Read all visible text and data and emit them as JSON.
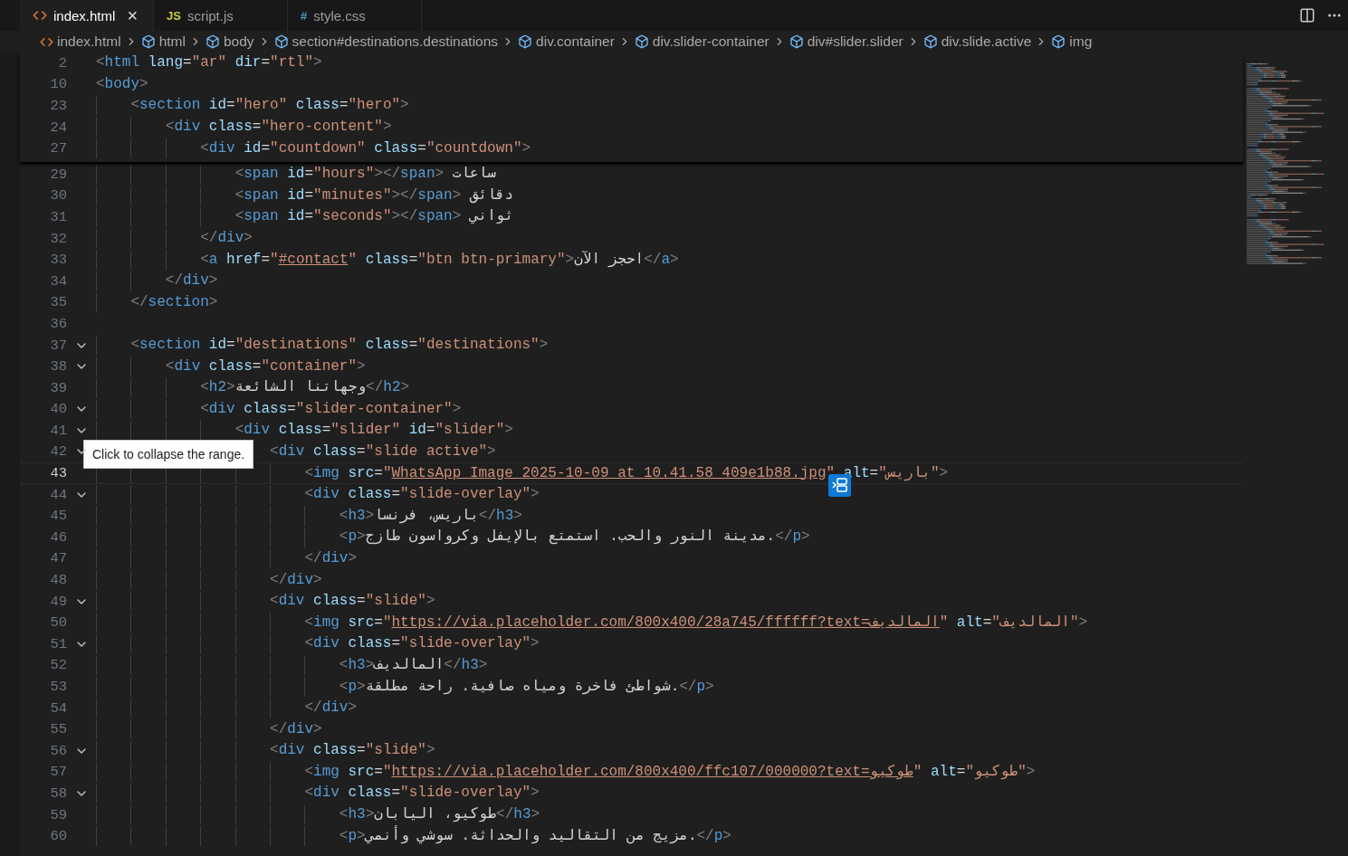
{
  "tabs": [
    {
      "label": "index.html",
      "kind": "html",
      "selected": true,
      "close": "×"
    },
    {
      "label": "script.js",
      "kind": "js",
      "glyph": "JS",
      "selected": false
    },
    {
      "label": "style.css",
      "kind": "css",
      "glyph": "#",
      "selected": false
    }
  ],
  "breadcrumb": [
    {
      "label": "index.html",
      "kind": "file"
    },
    {
      "label": "html",
      "kind": "element"
    },
    {
      "label": "body",
      "kind": "element"
    },
    {
      "label": "section#destinations.destinations",
      "kind": "element"
    },
    {
      "label": "div.container",
      "kind": "element"
    },
    {
      "label": "div.slider-container",
      "kind": "element"
    },
    {
      "label": "div#slider.slider",
      "kind": "element"
    },
    {
      "label": "div.slide.active",
      "kind": "element"
    },
    {
      "label": "img",
      "kind": "element"
    }
  ],
  "sticky_lines": [
    {
      "number": "2",
      "tokens": [
        {
          "kind": "br",
          "text": "<"
        },
        {
          "kind": "tag",
          "text": "html"
        },
        {
          "kind": "attr",
          "text": " lang"
        },
        {
          "kind": "op",
          "text": "="
        },
        {
          "kind": "str",
          "text": "\"ar\""
        },
        {
          "kind": "attr",
          "text": " dir"
        },
        {
          "kind": "op",
          "text": "="
        },
        {
          "kind": "str",
          "text": "\"rtl\""
        },
        {
          "kind": "br",
          "text": ">"
        }
      ]
    },
    {
      "number": "10",
      "tokens": [
        {
          "kind": "br",
          "text": "<"
        },
        {
          "kind": "tag",
          "text": "body"
        },
        {
          "kind": "br",
          "text": ">"
        }
      ]
    },
    {
      "number": "23",
      "tokens": [
        {
          "kind": "br",
          "text": "    <"
        },
        {
          "kind": "tag",
          "text": "section"
        },
        {
          "kind": "attr",
          "text": " id"
        },
        {
          "kind": "op",
          "text": "="
        },
        {
          "kind": "str",
          "text": "\"hero\""
        },
        {
          "kind": "attr",
          "text": " class"
        },
        {
          "kind": "op",
          "text": "="
        },
        {
          "kind": "str",
          "text": "\"hero\""
        },
        {
          "kind": "br",
          "text": ">"
        }
      ]
    },
    {
      "number": "24",
      "tokens": [
        {
          "kind": "br",
          "text": "        <"
        },
        {
          "kind": "tag",
          "text": "div"
        },
        {
          "kind": "attr",
          "text": " class"
        },
        {
          "kind": "op",
          "text": "="
        },
        {
          "kind": "str",
          "text": "\"hero-content\""
        },
        {
          "kind": "br",
          "text": ">"
        }
      ]
    },
    {
      "number": "27",
      "tokens": [
        {
          "kind": "br",
          "text": "            <"
        },
        {
          "kind": "tag",
          "text": "div"
        },
        {
          "kind": "attr",
          "text": " id"
        },
        {
          "kind": "op",
          "text": "="
        },
        {
          "kind": "str",
          "text": "\"countdown\""
        },
        {
          "kind": "attr",
          "text": " class"
        },
        {
          "kind": "op",
          "text": "="
        },
        {
          "kind": "str",
          "text": "\"countdown\""
        },
        {
          "kind": "br",
          "text": ">"
        }
      ]
    }
  ],
  "lines": [
    {
      "number": "29",
      "current": false,
      "tokens": [
        {
          "kind": "br",
          "text": "                <"
        },
        {
          "kind": "tag",
          "text": "span"
        },
        {
          "kind": "attr",
          "text": " id"
        },
        {
          "kind": "op",
          "text": "="
        },
        {
          "kind": "str",
          "text": "\"hours\""
        },
        {
          "kind": "br",
          "text": "></"
        },
        {
          "kind": "tag",
          "text": "span"
        },
        {
          "kind": "br",
          "text": ">"
        },
        {
          "kind": "text",
          "text": " ساعات"
        }
      ]
    },
    {
      "number": "30",
      "current": false,
      "tokens": [
        {
          "kind": "br",
          "text": "                <"
        },
        {
          "kind": "tag",
          "text": "span"
        },
        {
          "kind": "attr",
          "text": " id"
        },
        {
          "kind": "op",
          "text": "="
        },
        {
          "kind": "str",
          "text": "\"minutes\""
        },
        {
          "kind": "br",
          "text": "></"
        },
        {
          "kind": "tag",
          "text": "span"
        },
        {
          "kind": "br",
          "text": ">"
        },
        {
          "kind": "text",
          "text": " دقائق"
        }
      ]
    },
    {
      "number": "31",
      "current": false,
      "tokens": [
        {
          "kind": "br",
          "text": "                <"
        },
        {
          "kind": "tag",
          "text": "span"
        },
        {
          "kind": "attr",
          "text": " id"
        },
        {
          "kind": "op",
          "text": "="
        },
        {
          "kind": "str",
          "text": "\"seconds\""
        },
        {
          "kind": "br",
          "text": "></"
        },
        {
          "kind": "tag",
          "text": "span"
        },
        {
          "kind": "br",
          "text": ">"
        },
        {
          "kind": "text",
          "text": " ثواني"
        }
      ]
    },
    {
      "number": "32",
      "current": false,
      "tokens": [
        {
          "kind": "br",
          "text": "            </"
        },
        {
          "kind": "tag",
          "text": "div"
        },
        {
          "kind": "br",
          "text": ">"
        }
      ]
    },
    {
      "number": "33",
      "current": false,
      "tokens": [
        {
          "kind": "br",
          "text": "            <"
        },
        {
          "kind": "tag",
          "text": "a"
        },
        {
          "kind": "attr",
          "text": " href"
        },
        {
          "kind": "op",
          "text": "="
        },
        {
          "kind": "str",
          "text": "\""
        },
        {
          "kind": "link",
          "text": "#contact"
        },
        {
          "kind": "str",
          "text": "\""
        },
        {
          "kind": "attr",
          "text": " class"
        },
        {
          "kind": "op",
          "text": "="
        },
        {
          "kind": "str",
          "text": "\"btn btn-primary\""
        },
        {
          "kind": "br",
          "text": ">"
        },
        {
          "kind": "text",
          "text": "احجز الآن"
        },
        {
          "kind": "br",
          "text": "</"
        },
        {
          "kind": "tag",
          "text": "a"
        },
        {
          "kind": "br",
          "text": ">"
        }
      ]
    },
    {
      "number": "34",
      "current": false,
      "tokens": [
        {
          "kind": "br",
          "text": "        </"
        },
        {
          "kind": "tag",
          "text": "div"
        },
        {
          "kind": "br",
          "text": ">"
        }
      ]
    },
    {
      "number": "35",
      "current": false,
      "tokens": [
        {
          "kind": "br",
          "text": "    </"
        },
        {
          "kind": "tag",
          "text": "section"
        },
        {
          "kind": "br",
          "text": ">"
        }
      ]
    },
    {
      "number": "36",
      "current": false
    },
    {
      "number": "37",
      "current": false,
      "folded": false,
      "tokens": [
        {
          "kind": "br",
          "text": "    <"
        },
        {
          "kind": "tag",
          "text": "section"
        },
        {
          "kind": "attr",
          "text": " id"
        },
        {
          "kind": "op",
          "text": "="
        },
        {
          "kind": "str",
          "text": "\"destinations\""
        },
        {
          "kind": "attr",
          "text": " class"
        },
        {
          "kind": "op",
          "text": "="
        },
        {
          "kind": "str",
          "text": "\"destinations\""
        },
        {
          "kind": "br",
          "text": ">"
        }
      ]
    },
    {
      "number": "38",
      "current": false,
      "folded": false,
      "tokens": [
        {
          "kind": "br",
          "text": "        <"
        },
        {
          "kind": "tag",
          "text": "div"
        },
        {
          "kind": "attr",
          "text": " class"
        },
        {
          "kind": "op",
          "text": "="
        },
        {
          "kind": "str",
          "text": "\"container\""
        },
        {
          "kind": "br",
          "text": ">"
        }
      ]
    },
    {
      "number": "39",
      "current": false,
      "tokens": [
        {
          "kind": "br",
          "text": "            <"
        },
        {
          "kind": "tag",
          "text": "h2"
        },
        {
          "kind": "br",
          "text": ">"
        },
        {
          "kind": "text",
          "text": "وجهاتنا الشائعة"
        },
        {
          "kind": "br",
          "text": "</"
        },
        {
          "kind": "tag",
          "text": "h2"
        },
        {
          "kind": "br",
          "text": ">"
        }
      ]
    },
    {
      "number": "40",
      "current": false,
      "folded": false,
      "tokens": [
        {
          "kind": "br",
          "text": "            <"
        },
        {
          "kind": "tag",
          "text": "div"
        },
        {
          "kind": "attr",
          "text": " class"
        },
        {
          "kind": "op",
          "text": "="
        },
        {
          "kind": "str",
          "text": "\"slider-container\""
        },
        {
          "kind": "br",
          "text": ">"
        }
      ]
    },
    {
      "number": "41",
      "current": false,
      "folded": false,
      "tokens": [
        {
          "kind": "br",
          "text": "                <"
        },
        {
          "kind": "tag",
          "text": "div"
        },
        {
          "kind": "attr",
          "text": " class"
        },
        {
          "kind": "op",
          "text": "="
        },
        {
          "kind": "str",
          "text": "\"slider\""
        },
        {
          "kind": "attr",
          "text": " id"
        },
        {
          "kind": "op",
          "text": "="
        },
        {
          "kind": "str",
          "text": "\"slider\""
        },
        {
          "kind": "br",
          "text": ">"
        }
      ]
    },
    {
      "number": "42",
      "current": false,
      "folded": false,
      "tooltip": "Click to collapse the range.",
      "tokens": [
        {
          "kind": "br",
          "text": "                    <"
        },
        {
          "kind": "tag",
          "text": "div"
        },
        {
          "kind": "attr",
          "text": " class"
        },
        {
          "kind": "op",
          "text": "="
        },
        {
          "kind": "str",
          "text": "\"slide active\""
        },
        {
          "kind": "br",
          "text": ">"
        }
      ]
    },
    {
      "number": "43",
      "current": true,
      "tokens": [
        {
          "kind": "br",
          "text": "                        <"
        },
        {
          "kind": "tag",
          "text": "img"
        },
        {
          "kind": "attr",
          "text": " src"
        },
        {
          "kind": "op",
          "text": "="
        },
        {
          "kind": "str",
          "text": "\""
        },
        {
          "kind": "link",
          "text": "WhatsApp Image 2025-10-09 at 10.41.58_409e1b88.jpg"
        },
        {
          "kind": "str",
          "text": "\""
        },
        {
          "kind": "attr",
          "text": " alt"
        },
        {
          "kind": "op",
          "text": "="
        },
        {
          "kind": "str",
          "text": "\"باريس\""
        },
        {
          "kind": "br",
          "text": ">"
        }
      ]
    },
    {
      "number": "44",
      "current": false,
      "folded": false,
      "action_icon": true,
      "tokens": [
        {
          "kind": "br",
          "text": "                        <"
        },
        {
          "kind": "tag",
          "text": "div"
        },
        {
          "kind": "attr",
          "text": " class"
        },
        {
          "kind": "op",
          "text": "="
        },
        {
          "kind": "str",
          "text": "\"slide-overlay\""
        },
        {
          "kind": "br",
          "text": ">"
        }
      ]
    },
    {
      "number": "45",
      "current": false,
      "tokens": [
        {
          "kind": "br",
          "text": "                            <"
        },
        {
          "kind": "tag",
          "text": "h3"
        },
        {
          "kind": "br",
          "text": ">"
        },
        {
          "kind": "text",
          "text": "باريس، فرنسا"
        },
        {
          "kind": "br",
          "text": "</"
        },
        {
          "kind": "tag",
          "text": "h3"
        },
        {
          "kind": "br",
          "text": ">"
        }
      ]
    },
    {
      "number": "46",
      "current": false,
      "tokens": [
        {
          "kind": "br",
          "text": "                            <"
        },
        {
          "kind": "tag",
          "text": "p"
        },
        {
          "kind": "br",
          "text": ">"
        },
        {
          "kind": "text",
          "text": "مدينة النور والحب. استمتع بالإيفل وكرواسون طازج."
        },
        {
          "kind": "br",
          "text": "</"
        },
        {
          "kind": "tag",
          "text": "p"
        },
        {
          "kind": "br",
          "text": ">"
        }
      ]
    },
    {
      "number": "47",
      "current": false,
      "tokens": [
        {
          "kind": "br",
          "text": "                        </"
        },
        {
          "kind": "tag",
          "text": "div"
        },
        {
          "kind": "br",
          "text": ">"
        }
      ]
    },
    {
      "number": "48",
      "current": false,
      "tokens": [
        {
          "kind": "br",
          "text": "                    </"
        },
        {
          "kind": "tag",
          "text": "div"
        },
        {
          "kind": "br",
          "text": ">"
        }
      ]
    },
    {
      "number": "49",
      "current": false,
      "folded": false,
      "tokens": [
        {
          "kind": "br",
          "text": "                    <"
        },
        {
          "kind": "tag",
          "text": "div"
        },
        {
          "kind": "attr",
          "text": " class"
        },
        {
          "kind": "op",
          "text": "="
        },
        {
          "kind": "str",
          "text": "\"slide\""
        },
        {
          "kind": "br",
          "text": ">"
        }
      ]
    },
    {
      "number": "50",
      "current": false,
      "tokens": [
        {
          "kind": "br",
          "text": "                        <"
        },
        {
          "kind": "tag",
          "text": "img"
        },
        {
          "kind": "attr",
          "text": " src"
        },
        {
          "kind": "op",
          "text": "="
        },
        {
          "kind": "str",
          "text": "\""
        },
        {
          "kind": "link",
          "text": "https://via.placeholder.com/800x400/28a745/ffffff?text=المالديف"
        },
        {
          "kind": "str",
          "text": "\""
        },
        {
          "kind": "attr",
          "text": " alt"
        },
        {
          "kind": "op",
          "text": "="
        },
        {
          "kind": "str",
          "text": "\"المالديف\""
        },
        {
          "kind": "br",
          "text": ">"
        }
      ]
    },
    {
      "number": "51",
      "current": false,
      "folded": false,
      "tokens": [
        {
          "kind": "br",
          "text": "                        <"
        },
        {
          "kind": "tag",
          "text": "div"
        },
        {
          "kind": "attr",
          "text": " class"
        },
        {
          "kind": "op",
          "text": "="
        },
        {
          "kind": "str",
          "text": "\"slide-overlay\""
        },
        {
          "kind": "br",
          "text": ">"
        }
      ]
    },
    {
      "number": "52",
      "current": false,
      "tokens": [
        {
          "kind": "br",
          "text": "                            <"
        },
        {
          "kind": "tag",
          "text": "h3"
        },
        {
          "kind": "br",
          "text": ">"
        },
        {
          "kind": "text",
          "text": "المالديف"
        },
        {
          "kind": "br",
          "text": "</"
        },
        {
          "kind": "tag",
          "text": "h3"
        },
        {
          "kind": "br",
          "text": ">"
        }
      ]
    },
    {
      "number": "53",
      "current": false,
      "tokens": [
        {
          "kind": "br",
          "text": "                            <"
        },
        {
          "kind": "tag",
          "text": "p"
        },
        {
          "kind": "br",
          "text": ">"
        },
        {
          "kind": "text",
          "text": "شواطئ فاخرة ومياه صافية. راحة مطلقة."
        },
        {
          "kind": "br",
          "text": "</"
        },
        {
          "kind": "tag",
          "text": "p"
        },
        {
          "kind": "br",
          "text": ">"
        }
      ]
    },
    {
      "number": "54",
      "current": false,
      "tokens": [
        {
          "kind": "br",
          "text": "                        </"
        },
        {
          "kind": "tag",
          "text": "div"
        },
        {
          "kind": "br",
          "text": ">"
        }
      ]
    },
    {
      "number": "55",
      "current": false,
      "tokens": [
        {
          "kind": "br",
          "text": "                    </"
        },
        {
          "kind": "tag",
          "text": "div"
        },
        {
          "kind": "br",
          "text": ">"
        }
      ]
    },
    {
      "number": "56",
      "current": false,
      "folded": false,
      "tokens": [
        {
          "kind": "br",
          "text": "                    <"
        },
        {
          "kind": "tag",
          "text": "div"
        },
        {
          "kind": "attr",
          "text": " class"
        },
        {
          "kind": "op",
          "text": "="
        },
        {
          "kind": "str",
          "text": "\"slide\""
        },
        {
          "kind": "br",
          "text": ">"
        }
      ]
    },
    {
      "number": "57",
      "current": false,
      "tokens": [
        {
          "kind": "br",
          "text": "                        <"
        },
        {
          "kind": "tag",
          "text": "img"
        },
        {
          "kind": "attr",
          "text": " src"
        },
        {
          "kind": "op",
          "text": "="
        },
        {
          "kind": "str",
          "text": "\""
        },
        {
          "kind": "link",
          "text": "https://via.placeholder.com/800x400/ffc107/000000?text=طوكيو"
        },
        {
          "kind": "str",
          "text": "\""
        },
        {
          "kind": "attr",
          "text": " alt"
        },
        {
          "kind": "op",
          "text": "="
        },
        {
          "kind": "str",
          "text": "\"طوكيو\""
        },
        {
          "kind": "br",
          "text": ">"
        }
      ]
    },
    {
      "number": "58",
      "current": false,
      "folded": false,
      "tokens": [
        {
          "kind": "br",
          "text": "                        <"
        },
        {
          "kind": "tag",
          "text": "div"
        },
        {
          "kind": "attr",
          "text": " class"
        },
        {
          "kind": "op",
          "text": "="
        },
        {
          "kind": "str",
          "text": "\"slide-overlay\""
        },
        {
          "kind": "br",
          "text": ">"
        }
      ]
    },
    {
      "number": "59",
      "current": false,
      "tokens": [
        {
          "kind": "br",
          "text": "                            <"
        },
        {
          "kind": "tag",
          "text": "h3"
        },
        {
          "kind": "br",
          "text": ">"
        },
        {
          "kind": "text",
          "text": "طوكيو، اليابان"
        },
        {
          "kind": "br",
          "text": "</"
        },
        {
          "kind": "tag",
          "text": "h3"
        },
        {
          "kind": "br",
          "text": ">"
        }
      ]
    },
    {
      "number": "60",
      "current": false,
      "tokens": [
        {
          "kind": "br",
          "text": "                            <"
        },
        {
          "kind": "tag",
          "text": "p"
        },
        {
          "kind": "br",
          "text": ">"
        },
        {
          "kind": "text",
          "text": "مزيج من التقاليد والحداثة. سوشي وأنمي."
        },
        {
          "kind": "br",
          "text": "</"
        },
        {
          "kind": "tag",
          "text": "p"
        },
        {
          "kind": "br",
          "text": ">"
        }
      ]
    }
  ]
}
